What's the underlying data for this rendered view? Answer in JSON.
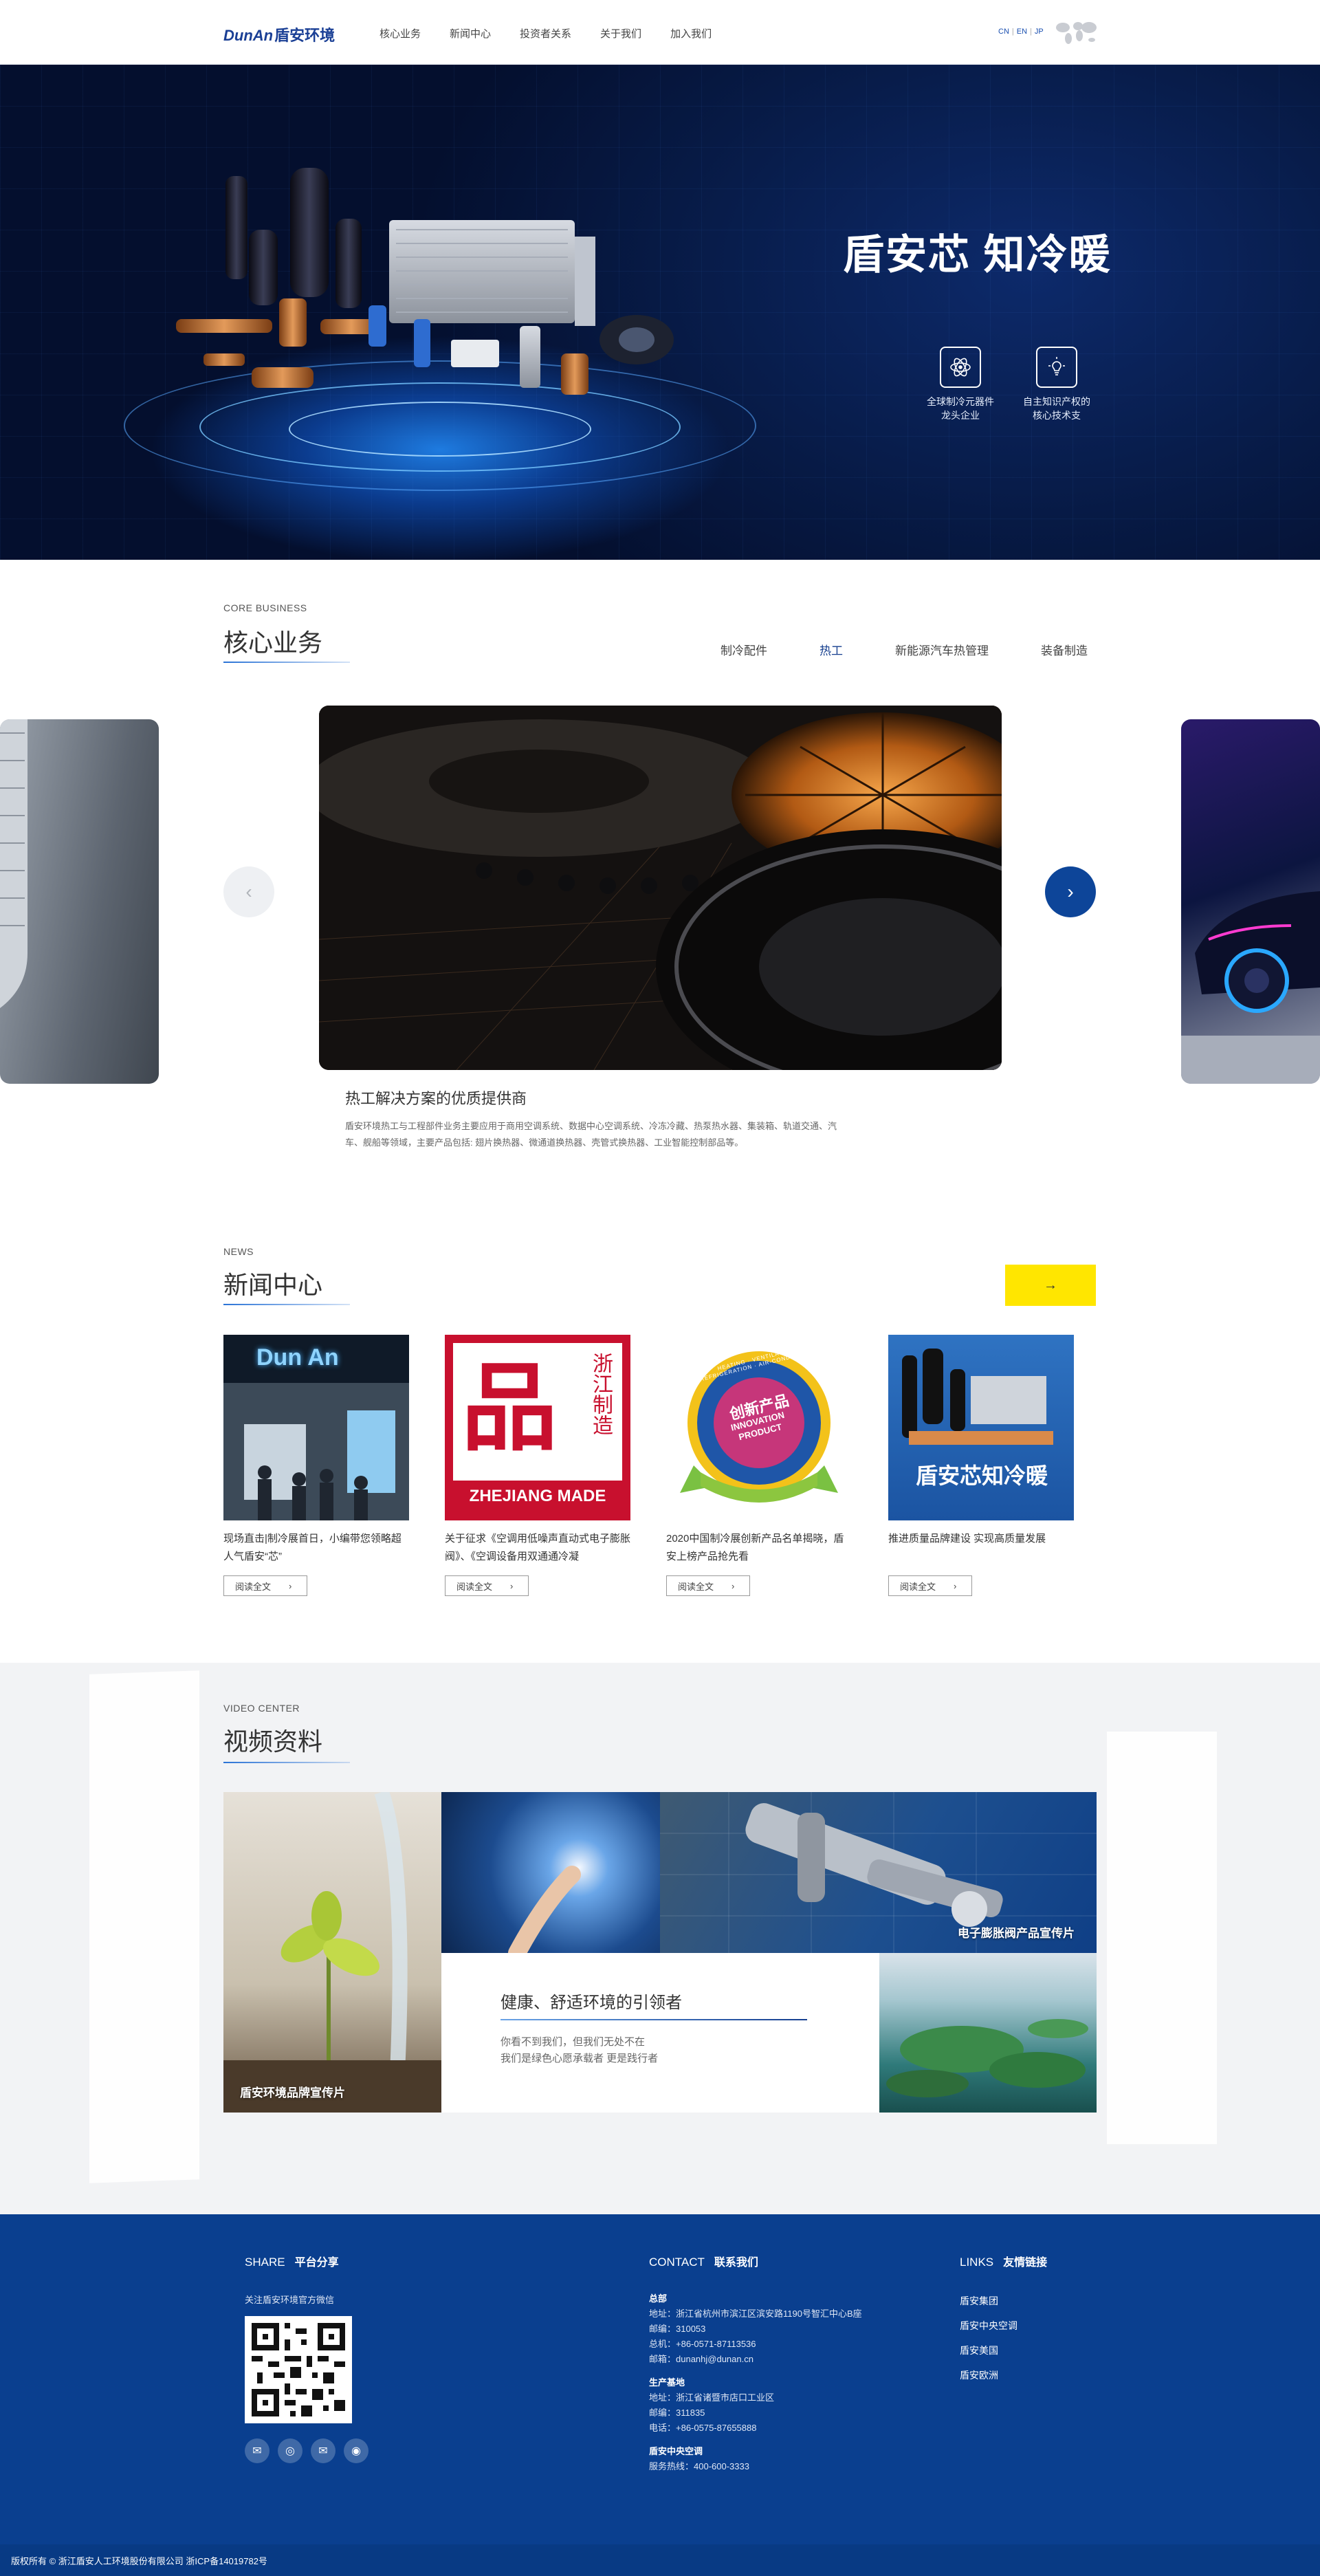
{
  "header": {
    "logo_en": "DunAn",
    "logo_cn": "盾安环境",
    "nav": [
      "核心业务",
      "新闻中心",
      "投资者关系",
      "关于我们",
      "加入我们"
    ],
    "lang": [
      "CN",
      "EN",
      "JP"
    ]
  },
  "hero": {
    "title": "盾安芯 知冷暖",
    "features": [
      {
        "icon": "atom-icon",
        "line1": "全球制冷元器件",
        "line2": "龙头企业"
      },
      {
        "icon": "lightbulb-icon",
        "line1": "自主知识产权的",
        "line2": "核心技术支"
      }
    ]
  },
  "core": {
    "en": "CORE BUSINESS",
    "cn": "核心业务",
    "tabs": [
      "制冷配件",
      "热工",
      "新能源汽车热管理",
      "装备制造"
    ],
    "active_tab": "热工",
    "title": "热工解决方案的优质提供商",
    "desc": "盾安环境热工与工程部件业务主要应用于商用空调系统、数据中心空调系统、冷冻冷藏、热泵热水器、集装箱、轨道交通、汽车、舰船等领域，主要产品包括: 翅片换热器、微通道换热器、壳管式换热器、工业智能控制部品等。"
  },
  "news": {
    "en": "NEWS",
    "cn": "新闻中心",
    "more_icon": "arrow-right-icon",
    "items": [
      {
        "title": "现场直击|制冷展首日，小编带您领略超人气盾安“芯”",
        "btn": "阅读全文"
      },
      {
        "title": "关于征求《空调用低噪声直动式电子膨胀阀》、《空调设备用双通通冷凝",
        "btn": "阅读全文",
        "img_text1": "浙江制造",
        "img_text2": "ZHEJIANG MADE"
      },
      {
        "title": "2020中国制冷展创新产品名单揭晓，盾安上榜产品抢先看",
        "btn": "阅读全文",
        "img_text1": "创新产品",
        "img_text2": "INNOVATION PRODUCT",
        "img_text3": "HEATING · VENTILATION · REFRIGERATION · AIR-CONDITIONING"
      },
      {
        "title": "推进质量品牌建设 实现高质量发展",
        "btn": "阅读全文",
        "img_text1": "盾安芯知冷暖"
      }
    ],
    "sign_text": "Dun An"
  },
  "video": {
    "en": "VIDEO CENTER",
    "cn": "视频资料",
    "label1": "盾安环境品牌宣传片",
    "label2": "电子膨胀阀产品宣传片",
    "slogan": "健康、舒适环境的引领者",
    "sub1": "你看不到我们，但我们无处不在",
    "sub2": "我们是绿色心愿承载者 更是践行者"
  },
  "footer": {
    "share_en": "SHARE",
    "share_cn": "平台分享",
    "follow": "关注盾安环境官方微信",
    "contact_en": "CONTACT",
    "contact_cn": "联系我们",
    "hq_title": "总部",
    "hq_addr": "地址：浙江省杭州市滨江区滨安路1190号智汇中心B座",
    "hq_zip": "邮编：310053",
    "hq_tel": "总机：+86-0571-87113536",
    "hq_mail": "邮箱：dunanhj@dunan.cn",
    "prod_title": "生产基地",
    "prod_addr": "地址：浙江省诸暨市店口工业区",
    "prod_zip": "邮编：311835",
    "prod_tel": "电话：+86-0575-87655888",
    "ac_title": "盾安中央空调",
    "ac_tel": "服务热线：400-600-3333",
    "links_en": "LINKS",
    "links_cn": "友情链接",
    "links": [
      "盾安集团",
      "盾安中央空调",
      "盾安美国",
      "盾安欧洲"
    ],
    "social": [
      "wechat-icon",
      "weibo-icon",
      "mail-icon",
      "qq-icon"
    ],
    "copyright": "版权所有 © 浙江盾安人工环境股份有限公司 浙ICP备14019782号"
  },
  "colors": {
    "brand_blue": "#0a3f8f",
    "accent_yellow": "#ffe600",
    "tab_active": "#163f8f"
  }
}
